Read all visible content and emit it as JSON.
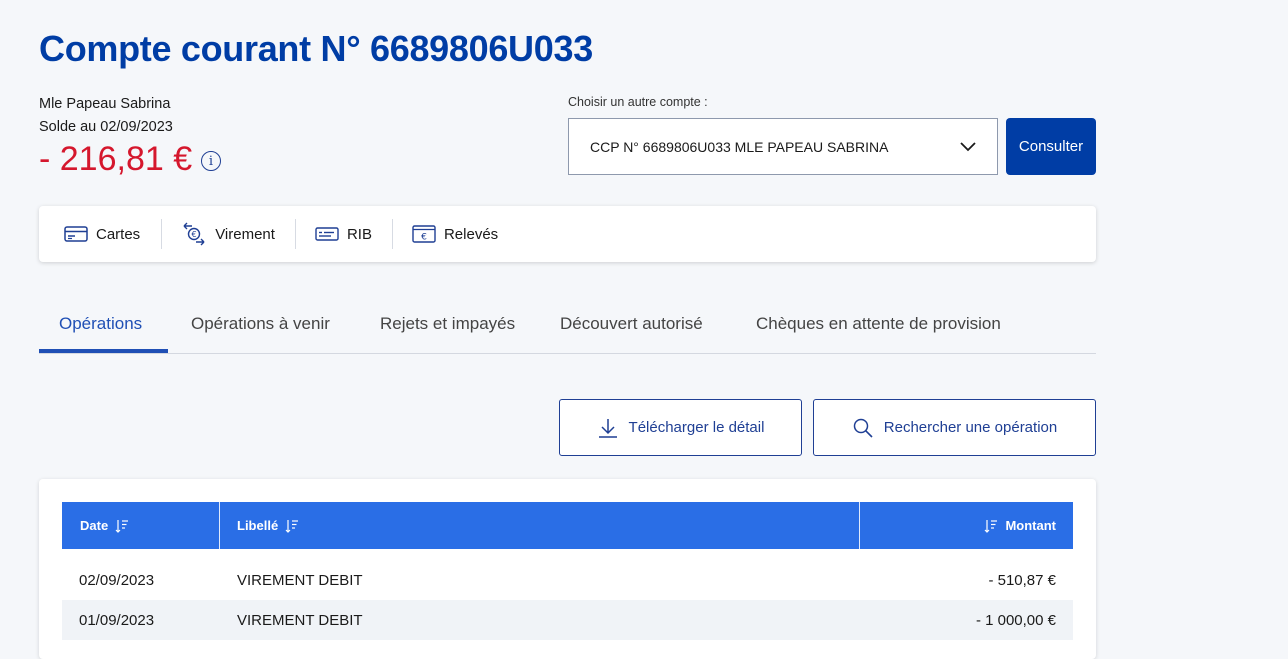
{
  "page": {
    "title": "Compte courant N° 6689806U033"
  },
  "account": {
    "holder": "Mle Papeau Sabrina",
    "balance_date_label": "Solde au 02/09/2023",
    "balance": "- 216,81 €",
    "info_icon": "i"
  },
  "account_switcher": {
    "label": "Choisir un autre compte :",
    "selected": "CCP N° 6689806U033 MLE PAPEAU SABRINA",
    "button": "Consulter"
  },
  "quick_actions": [
    {
      "label": "Cartes",
      "icon": "card-icon"
    },
    {
      "label": "Virement",
      "icon": "transfer-icon"
    },
    {
      "label": "RIB",
      "icon": "rib-icon"
    },
    {
      "label": "Relevés",
      "icon": "statement-icon"
    }
  ],
  "tabs": [
    {
      "label": "Opérations",
      "active": true
    },
    {
      "label": "Opérations à venir",
      "active": false
    },
    {
      "label": "Rejets et impayés",
      "active": false
    },
    {
      "label": "Découvert autorisé",
      "active": false
    },
    {
      "label": "Chèques en attente de provision",
      "active": false
    }
  ],
  "actions": {
    "download": "Télécharger le détail",
    "search": "Rechercher une opération"
  },
  "table": {
    "columns": [
      "Date",
      "Libellé",
      "Montant"
    ],
    "rows": [
      {
        "date": "02/09/2023",
        "label": "VIREMENT DEBIT",
        "amount": "- 510,87 €"
      },
      {
        "date": "01/09/2023",
        "label": "VIREMENT DEBIT",
        "amount": "- 1 000,00 €"
      }
    ]
  },
  "colors": {
    "primary": "#003da5",
    "negative": "#d5172d",
    "table_header": "#2a6ee6"
  }
}
